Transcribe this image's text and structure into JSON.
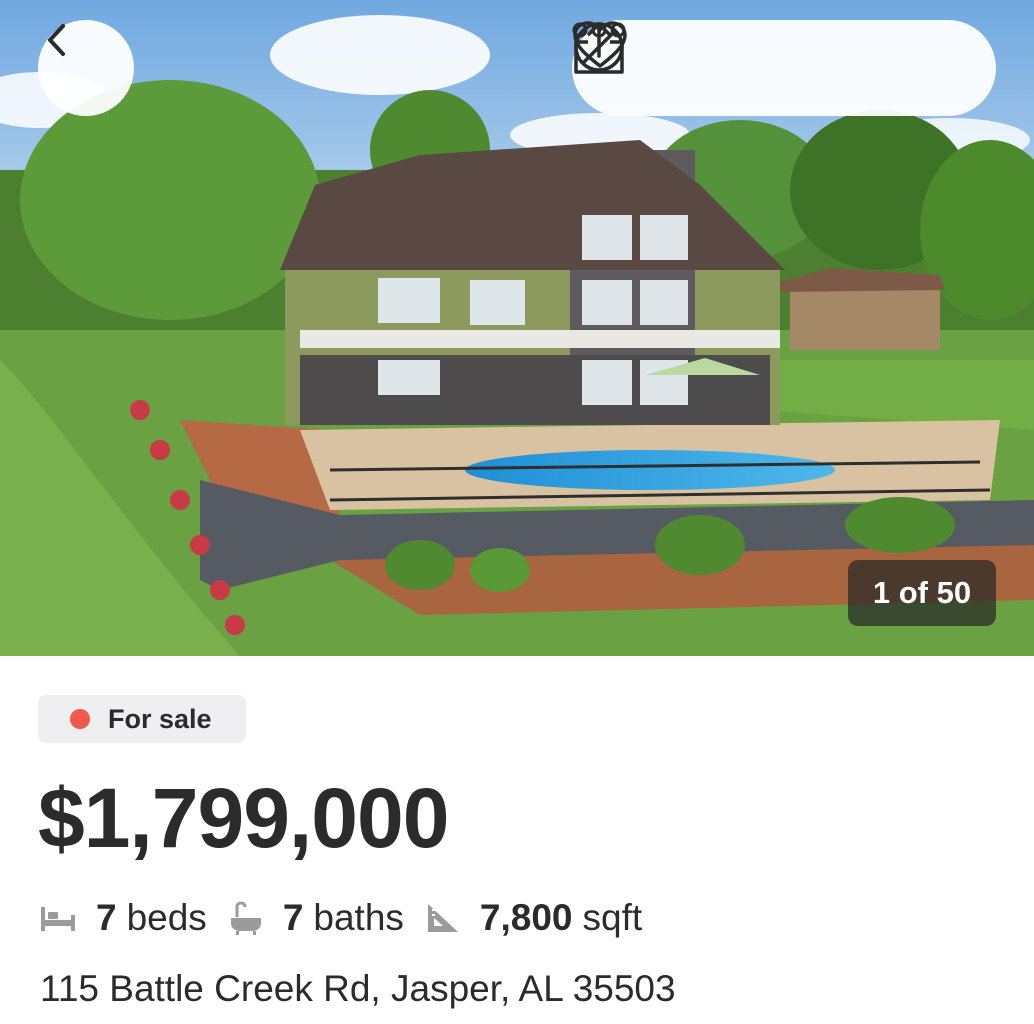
{
  "photo": {
    "counter": "1 of 50"
  },
  "nav": {
    "back_icon": "chevron-left-icon",
    "actions": [
      {
        "name": "favorite",
        "icon": "heart-icon"
      },
      {
        "name": "share",
        "icon": "share-icon"
      },
      {
        "name": "hide",
        "icon": "block-icon"
      },
      {
        "name": "more",
        "icon": "more-horizontal-icon"
      }
    ]
  },
  "listing": {
    "status": "For sale",
    "status_color": "#ef5a4f",
    "price": "$1,799,000",
    "beds": {
      "value": "7",
      "unit": "beds",
      "icon": "bed-icon"
    },
    "baths": {
      "value": "7",
      "unit": "baths",
      "icon": "bath-icon"
    },
    "sqft": {
      "value": "7,800",
      "unit": "sqft",
      "icon": "ruler-triangle-icon"
    },
    "address": "115 Battle Creek Rd, Jasper, AL 35503"
  }
}
